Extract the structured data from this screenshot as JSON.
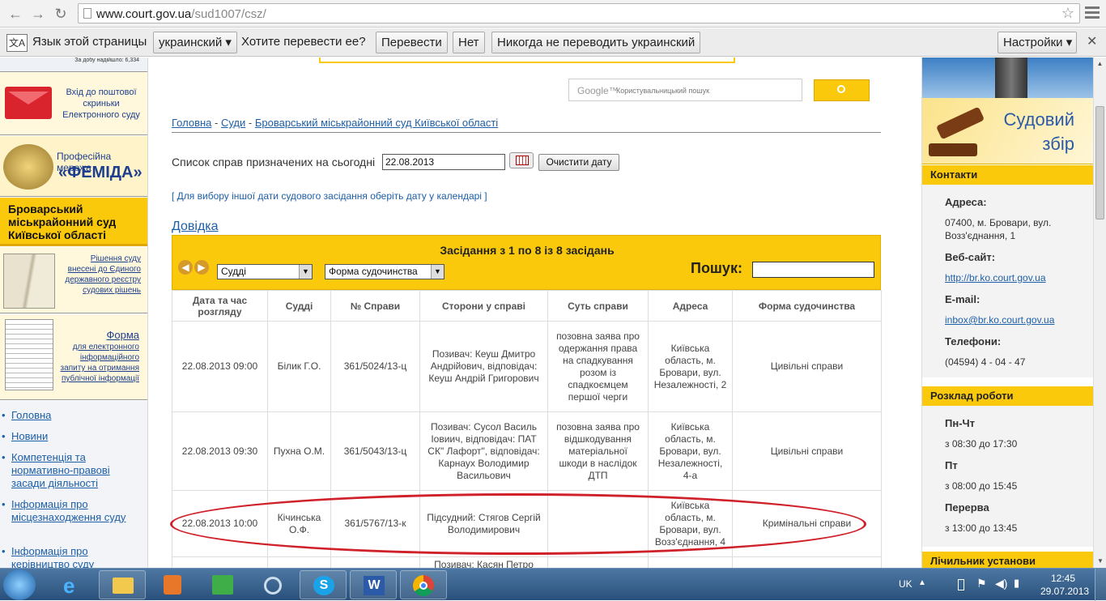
{
  "browser": {
    "url_host": "www.court.gov.ua",
    "url_path": "/sud1007/csz/"
  },
  "translate_bar": {
    "prompt_label": "Язык этой страницы",
    "language": "украинский",
    "question": "Хотите перевести ее?",
    "translate_btn": "Перевести",
    "no_btn": "Нет",
    "never_btn": "Никогда не переводить украинский",
    "settings_btn": "Настройки"
  },
  "left": {
    "top_small": "За добу надійшло: 6,334",
    "mail_text": "Вхід до поштової скриньки Електронного суду",
    "femida_line1": "Професійна мережа",
    "femida_line2": "«ФЕМІДА»",
    "court_name": "Броварський міськрайонний суд Київської області",
    "registry_link": "Рішення суду внесені до Єдиного державного реєстру судових рішень",
    "form_title": "Форма",
    "form_text": "для електронного інформаційного запиту на отримання публічної інформації",
    "nav": [
      "Головна",
      "Новини",
      "Компетенція та нормативно-правові засади діяльності",
      "Інформація про місцезнаходження суду",
      "Інформація про керівництво суду"
    ]
  },
  "search": {
    "google_label": "Google™",
    "placeholder": "Користувальницький пошук"
  },
  "breadcrumb": {
    "home": "Головна",
    "sep1": " - ",
    "courts": "Суди",
    "sep2": " - ",
    "current": "Броварський міськрайонний суд Київської області"
  },
  "date_filter": {
    "label": "Список справ призначених на сьогодні",
    "value": "22.08.2013",
    "clear_btn": "Очистити дату"
  },
  "calendar_hint": "[ Для вибору іншої дати судового засідання оберіть дату у календарі ]",
  "help_link": "Довідка",
  "sessions": {
    "title": "Засідання з 1 по 8 із 8 засідань",
    "judges_select": "Судді",
    "form_select": "Форма судочинства",
    "search_label": "Пошук:",
    "columns": [
      "Дата та час розгляду",
      "Судді",
      "№ Справи",
      "Сторони у справі",
      "Суть справи",
      "Адреса",
      "Форма судочинства"
    ],
    "rows": [
      [
        "22.08.2013 09:00",
        "Білик Г.О.",
        "361/5024/13-ц",
        "Позивач: Кеуш Дмитро Андрійович, відповідач: Кеуш Андрій Григорович",
        "позовна заява про одержання права на спадкування розом із спадкоємцем першої черги",
        "Київська область, м. Бровари, вул. Незалежності, 2",
        "Цивільні справи"
      ],
      [
        "22.08.2013 09:30",
        "Пухна О.М.",
        "361/5043/13-ц",
        "Позивач: Сусол Василь Іовиич, відповідач: ПАТ СК\" Лафорт\", відповідач: Карнаух Володимир Васильович",
        "позовна заява про відшкодування матеріальної шкоди в наслідок ДТП",
        "Київська область, м. Бровари, вул. Незалежності, 4-а",
        "Цивільні справи"
      ],
      [
        "22.08.2013 10:00",
        "Кічинська О.Ф.",
        "361/5767/13-к",
        "Підсудний: Стягов Сергій Володимирович",
        "",
        "Київська область, м. Бровари, вул. Возз'єднання, 4",
        "Кримінальні справи"
      ],
      [
        "",
        "",
        "",
        "Позивач: Касян Петро",
        "",
        "",
        ""
      ]
    ]
  },
  "right": {
    "banner_title1": "Судовий",
    "banner_title2": "збір",
    "contacts_head": "Контакти",
    "address_label": "Адреса:",
    "address_1": "07400, м. Бровари, вул.",
    "address_2": "Возз'єднання, 1",
    "web_label": "Веб-сайт:",
    "web_value": "http://br.ko.court.gov.ua",
    "email_label": "E-mail:",
    "email_value": "inbox@br.ko.court.gov.ua",
    "phone_label": "Телефони:",
    "phone_value": "(04594) 4 - 04 - 47",
    "schedule_head": "Розклад роботи",
    "mon_thu": "Пн-Чт",
    "mon_thu_hours": "з 08:30 до 17:30",
    "fri": "Пт",
    "fri_hours": "з 08:00 до 15:45",
    "break": "Перерва",
    "break_hours": "з 13:00 до 13:45",
    "counter_head": "Лічильник установи"
  },
  "taskbar": {
    "lang": "UK",
    "time": "12:45",
    "date": "29.07.2013"
  },
  "colors": {
    "accent": "#fbc90b",
    "link": "#1d5fa8",
    "highlight": "#d0212a"
  }
}
